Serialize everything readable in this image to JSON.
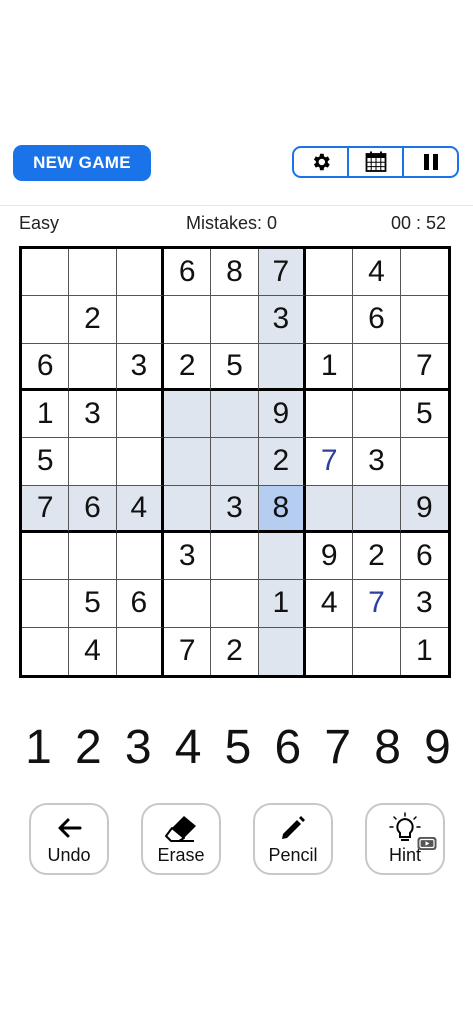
{
  "header": {
    "new_game_label": "NEW GAME",
    "toolbar": [
      {
        "icon": "gear-icon"
      },
      {
        "icon": "calendar-icon"
      },
      {
        "icon": "pause-icon"
      }
    ]
  },
  "status": {
    "difficulty": "Easy",
    "mistakes": "Mistakes: 0",
    "timer": "00 : 52"
  },
  "board": {
    "selected": {
      "row": 5,
      "col": 5
    },
    "rows": [
      [
        "",
        "",
        "",
        "6",
        "8",
        "7",
        "",
        "4",
        ""
      ],
      [
        "",
        "2",
        "",
        "",
        "",
        "3",
        "",
        "6",
        ""
      ],
      [
        "6",
        "",
        "3",
        "2",
        "5",
        "",
        "1",
        "",
        "7"
      ],
      [
        "1",
        "3",
        "",
        "",
        "",
        "9",
        "",
        "",
        "5"
      ],
      [
        "5",
        "",
        "",
        "",
        "",
        "2",
        "7",
        "3",
        ""
      ],
      [
        "7",
        "6",
        "4",
        "",
        "3",
        "8",
        "",
        "",
        "9"
      ],
      [
        "",
        "",
        "",
        "3",
        "",
        "",
        "9",
        "2",
        "6"
      ],
      [
        "",
        "5",
        "6",
        "",
        "",
        "1",
        "4",
        "7",
        "3"
      ],
      [
        "",
        "4",
        "",
        "7",
        "2",
        "",
        "",
        "",
        "1"
      ]
    ],
    "user_entries": [
      [
        3,
        3
      ],
      [
        4,
        6
      ],
      [
        7,
        7
      ]
    ],
    "colors": {
      "given": "#111111",
      "user": "#2f3fa0",
      "highlight": "#dfe5ef",
      "selected": "#b5cdf0"
    }
  },
  "numpad": [
    "1",
    "2",
    "3",
    "4",
    "5",
    "6",
    "7",
    "8",
    "9"
  ],
  "actions": {
    "undo": "Undo",
    "erase": "Erase",
    "pencil": "Pencil",
    "hint": "Hint"
  },
  "accent": "#1a73e8"
}
